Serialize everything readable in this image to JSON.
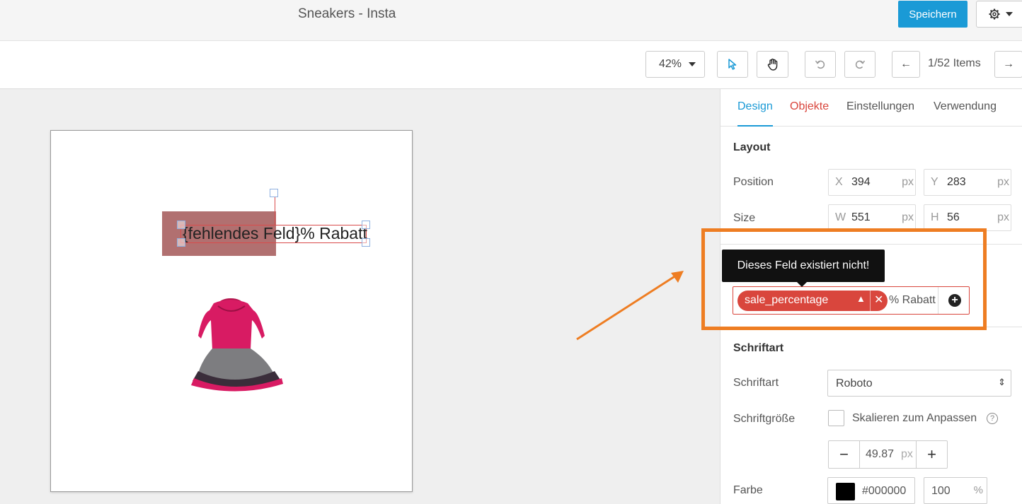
{
  "header": {
    "title": "Sneakers - Insta",
    "save_label": "Speichern"
  },
  "toolbar": {
    "zoom": "42%",
    "items_counter": "1/52 Items",
    "prev_arrow": "←",
    "next_arrow": "→"
  },
  "canvas": {
    "text": "{fehlendes Feld}% Rabatt"
  },
  "panel": {
    "tabs": [
      {
        "label": "Design"
      },
      {
        "label": "Objekte"
      },
      {
        "label": "Einstellungen"
      },
      {
        "label": "Verwendung"
      }
    ],
    "layout": {
      "title": "Layout",
      "position_label": "Position",
      "size_label": "Size",
      "x_prefix": "X",
      "x_value": "394",
      "y_prefix": "Y",
      "y_value": "283",
      "w_prefix": "W",
      "w_value": "551",
      "h_prefix": "H",
      "h_value": "56",
      "unit": "px"
    },
    "text_field": {
      "tooltip": "Dieses Feld existiert nicht!",
      "chip_label": "sale_percentage",
      "suffix": "% Rabatt"
    },
    "font": {
      "title": "Schriftart",
      "font_label": "Schriftart",
      "font_value": "Roboto",
      "size_label": "Schriftgröße",
      "scale_label": "Skalieren zum Anpassen",
      "size_value": "49.87",
      "size_unit": "px",
      "color_label": "Farbe",
      "color_hex": "#000000",
      "opacity_value": "100",
      "opacity_unit": "%"
    }
  },
  "colors": {
    "accent": "#1a9ad6",
    "error": "#d9463d",
    "highlight": "#ee7d22"
  }
}
